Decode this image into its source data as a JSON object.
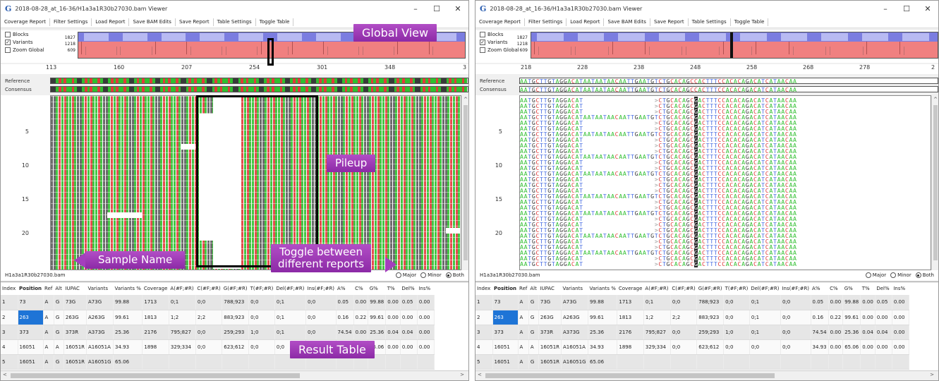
{
  "windows": [
    {
      "title": "2018-08-28_at_16-36/H1a3a1R30b27030.bam Viewer",
      "controls": {
        "minimize": "–",
        "maximize": "☐",
        "close": "✕"
      },
      "menu": [
        "Coverage Report",
        "Filter Settings",
        "Load Report",
        "Save BAM Edits",
        "Save Report",
        "Table Settings",
        "Toggle Table"
      ],
      "global": {
        "checkboxes": [
          {
            "label": "Blocks",
            "checked": false
          },
          {
            "label": "Variants",
            "checked": true
          },
          {
            "label": "Zoom Global",
            "checked": false
          }
        ],
        "y_labels": [
          "1827",
          "1218",
          "609"
        ]
      },
      "positions": [
        "113",
        "160",
        "207",
        "254",
        "301",
        "348",
        "3"
      ],
      "ref_labels": [
        "Reference",
        "Consensus"
      ],
      "row_numbers": [
        "5",
        "10",
        "15",
        "20"
      ],
      "sample_name": "H1a3a1R30b27030.bam",
      "report_options": [
        {
          "label": "Major",
          "selected": false
        },
        {
          "label": "Minor",
          "selected": false
        },
        {
          "label": "Both",
          "selected": true
        }
      ]
    },
    {
      "title": "2018-08-28_at_16-36/H1a3a1R30b27030.bam Viewer",
      "controls": {
        "minimize": "–",
        "maximize": "☐",
        "close": "✕"
      },
      "menu": [
        "Coverage Report",
        "Filter Settings",
        "Load Report",
        "Save BAM Edits",
        "Save Report",
        "Table Settings",
        "Toggle Table"
      ],
      "global": {
        "checkboxes": [
          {
            "label": "Blocks",
            "checked": false
          },
          {
            "label": "Variants",
            "checked": true
          },
          {
            "label": "Zoom Global",
            "checked": false
          }
        ],
        "y_labels": [
          "1827",
          "1218",
          "609"
        ]
      },
      "positions": [
        "218",
        "228",
        "238",
        "248",
        "258",
        "268",
        "278",
        "2"
      ],
      "ref_labels": [
        "Reference",
        "Consensus"
      ],
      "row_numbers": [
        "5",
        "10",
        "15",
        "20"
      ],
      "sample_name": "H1a3a1R30b27030.bam",
      "report_options": [
        {
          "label": "Major",
          "selected": false
        },
        {
          "label": "Minor",
          "selected": false
        },
        {
          "label": "Both",
          "selected": true
        }
      ],
      "reference_sequence": "AATGCTTGTAGGACATAATAATAACAATTGAATGTCTGCACAGCCACTTTCCACACAGACATCATAACAA"
    }
  ],
  "table": {
    "headers": [
      "Index",
      "Position",
      "Ref",
      "Alt",
      "IUPAC",
      "Variants",
      "Variants %",
      "Coverage",
      "A(#F;#R)",
      "C(#F;#R)",
      "G(#F;#R)",
      "T(#F;#R)",
      "Del(#F;#R)",
      "Ins(#F;#R)",
      "A%",
      "C%",
      "G%",
      "T%",
      "Del%",
      "Ins%"
    ],
    "rows": [
      [
        "1",
        "73",
        "A",
        "G",
        "73G",
        "A73G",
        "99.88",
        "1713",
        "0;1",
        "0;0",
        "788;923",
        "0;0",
        "0;1",
        "0;0",
        "0.05",
        "0.00",
        "99.88",
        "0.00",
        "0.05",
        "0.00"
      ],
      [
        "2",
        "263",
        "A",
        "G",
        "263G",
        "A263G",
        "99.61",
        "1813",
        "1;2",
        "2;2",
        "883;923",
        "0;0",
        "0;1",
        "0;0",
        "0.16",
        "0.22",
        "99.61",
        "0.00",
        "0.00",
        "0.00"
      ],
      [
        "3",
        "373",
        "A",
        "G",
        "373R",
        "A373G",
        "25.36",
        "2176",
        "795;827",
        "0;0",
        "259;293",
        "1;0",
        "0;1",
        "0;0",
        "74.54",
        "0.00",
        "25.36",
        "0.04",
        "0.04",
        "0.00"
      ],
      [
        "4",
        "16051",
        "A",
        "A",
        "16051R",
        "A16051A",
        "34.93",
        "1898",
        "329;334",
        "0;0",
        "623;612",
        "0;0",
        "0;0",
        "0;0",
        "34.93",
        "0.00",
        "65.06",
        "0.00",
        "0.00",
        "0.00"
      ],
      [
        "5",
        "16051",
        "A",
        "G",
        "16051R",
        "A16051G",
        "65.06",
        "",
        "",
        "",
        "",
        "",
        "",
        "",
        "",
        "",
        "",
        "",
        "",
        ""
      ]
    ]
  },
  "callouts": {
    "global_view": "Global View",
    "pileup": "Pileup",
    "sample_name": "Sample Name",
    "toggle_line1": "Toggle between",
    "toggle_line2": "different reports",
    "result_table": "Result Table"
  },
  "colors": {
    "A": "#2fbf2f",
    "C": "#e03a3a",
    "G": "#3a3a3a",
    "T": "#4a6fe3",
    "del": "#ffffff",
    "callout": "#a43fbd",
    "selected": "#1e74d6",
    "blocks_band": "#7b7de0",
    "variants_band": "#f08080"
  }
}
